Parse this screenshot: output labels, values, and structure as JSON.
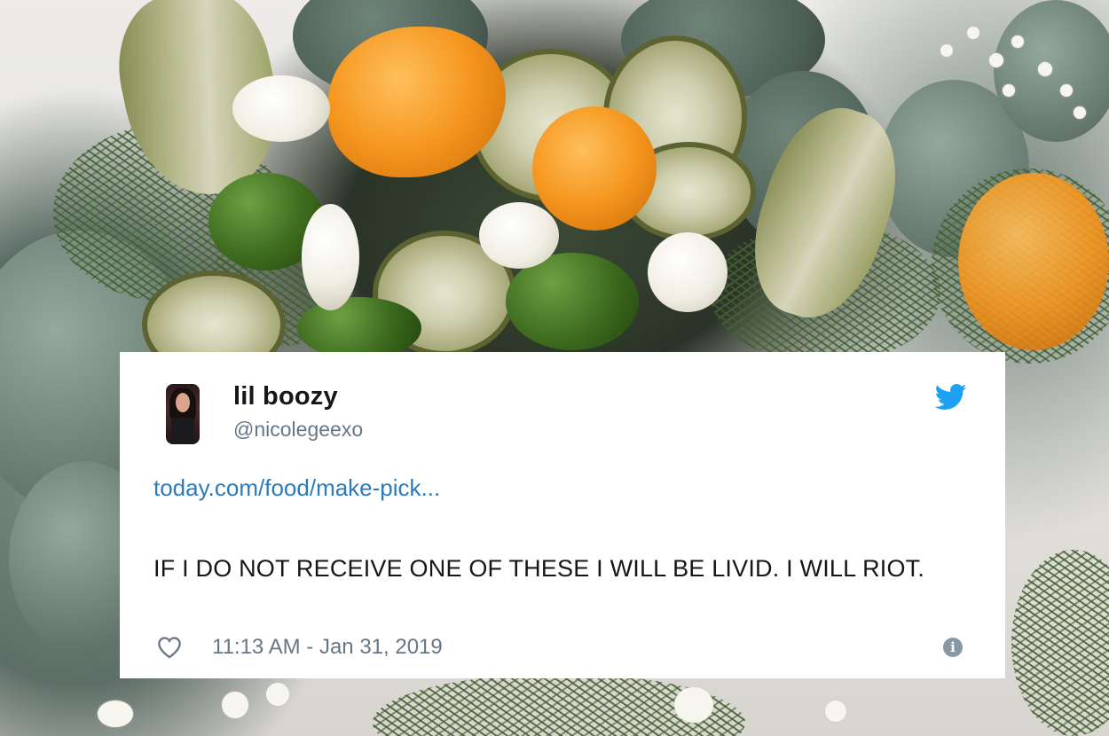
{
  "tweet": {
    "display_name": "lil boozy",
    "handle": "@nicolegeexo",
    "link_text": "today.com/food/make-pick...",
    "text": "IF I DO NOT RECEIVE ONE OF THESE I WILL BE LIVID. I WILL RIOT.",
    "timestamp": "11:13 AM - Jan 31, 2019",
    "icons": {
      "brand": "twitter-bird-icon",
      "like": "heart-icon",
      "info": "info-icon"
    },
    "colors": {
      "brand_blue": "#1da1f2",
      "link_blue": "#2b7bb9",
      "text": "#14171a",
      "muted": "#657786"
    }
  },
  "background": {
    "subject": "pickle and pepper bouquet photo",
    "icon": "photo-background"
  }
}
